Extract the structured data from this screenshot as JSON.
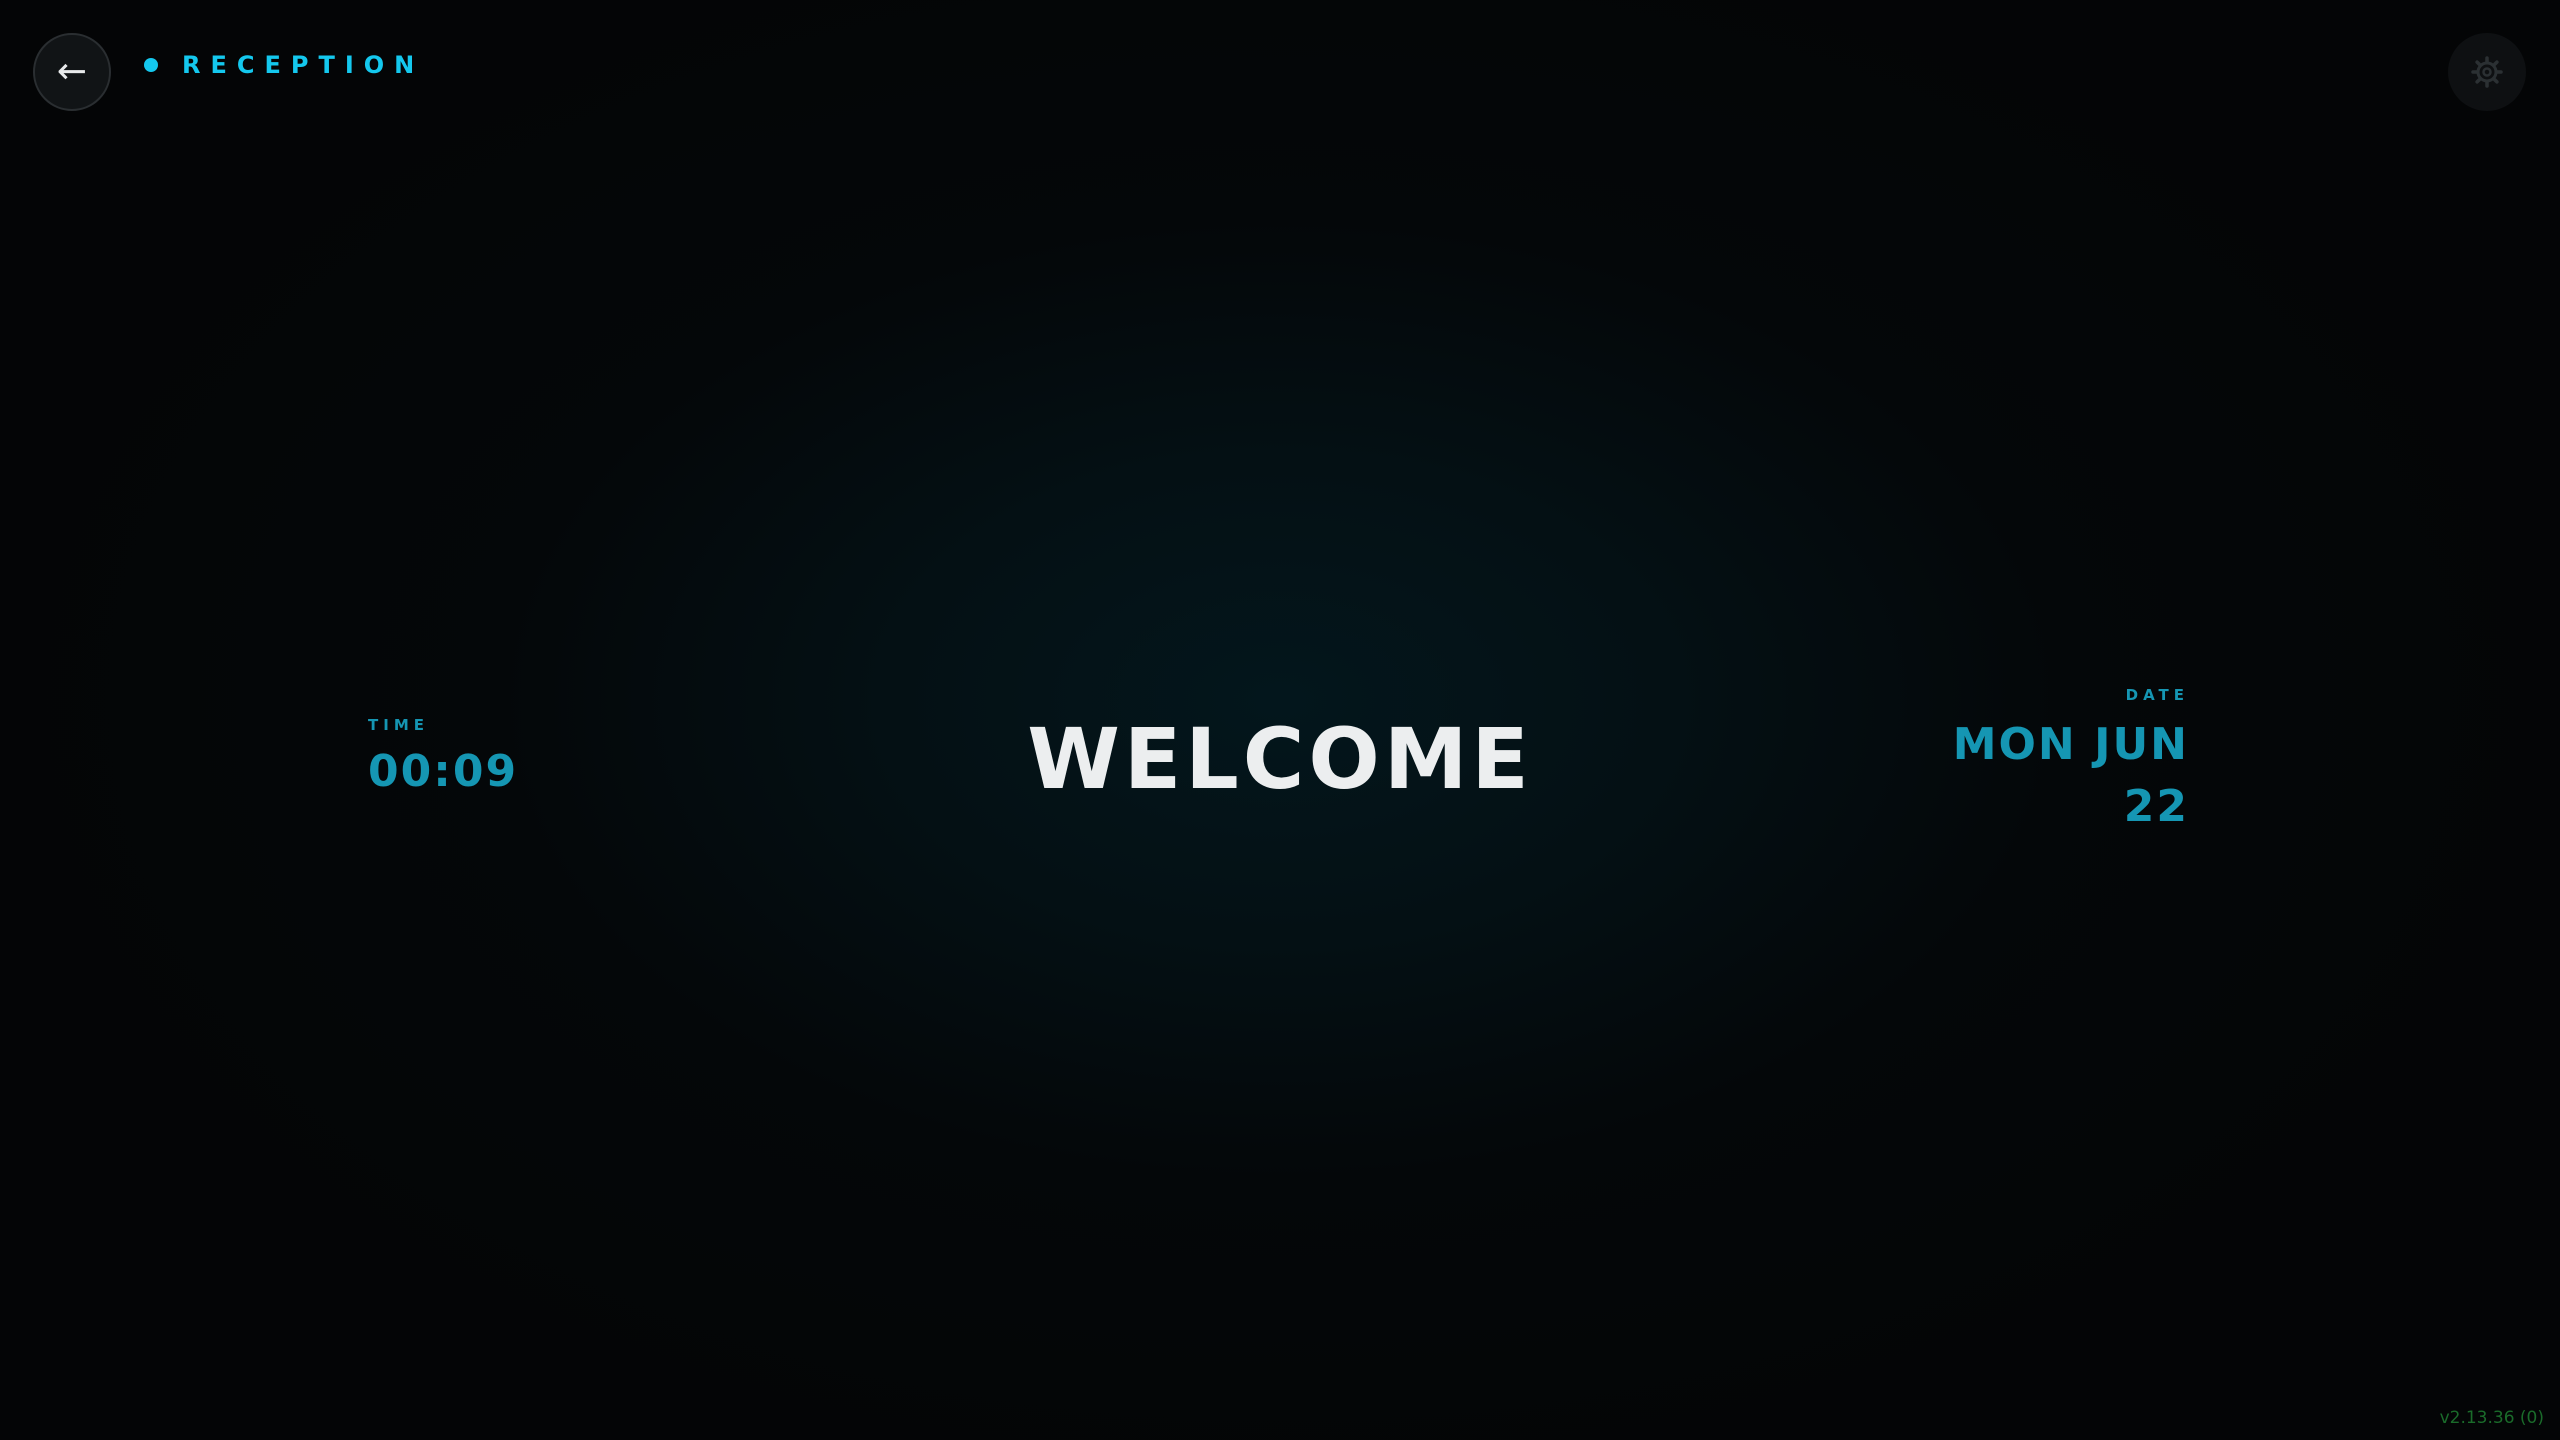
{
  "header": {
    "back_icon": "arrow-left-icon",
    "back_glyph": "←",
    "location_label": "RECEPTION",
    "accent_color": "#14c8ee",
    "settings_icon": "gear-icon"
  },
  "main": {
    "time": {
      "label": "TIME",
      "value": "00:09"
    },
    "welcome": "WELCOME",
    "date": {
      "label": "DATE",
      "value": "MON JUN 22"
    },
    "info_color": "#1596b3"
  },
  "footer": {
    "version": "v2.13.36 (0)"
  }
}
